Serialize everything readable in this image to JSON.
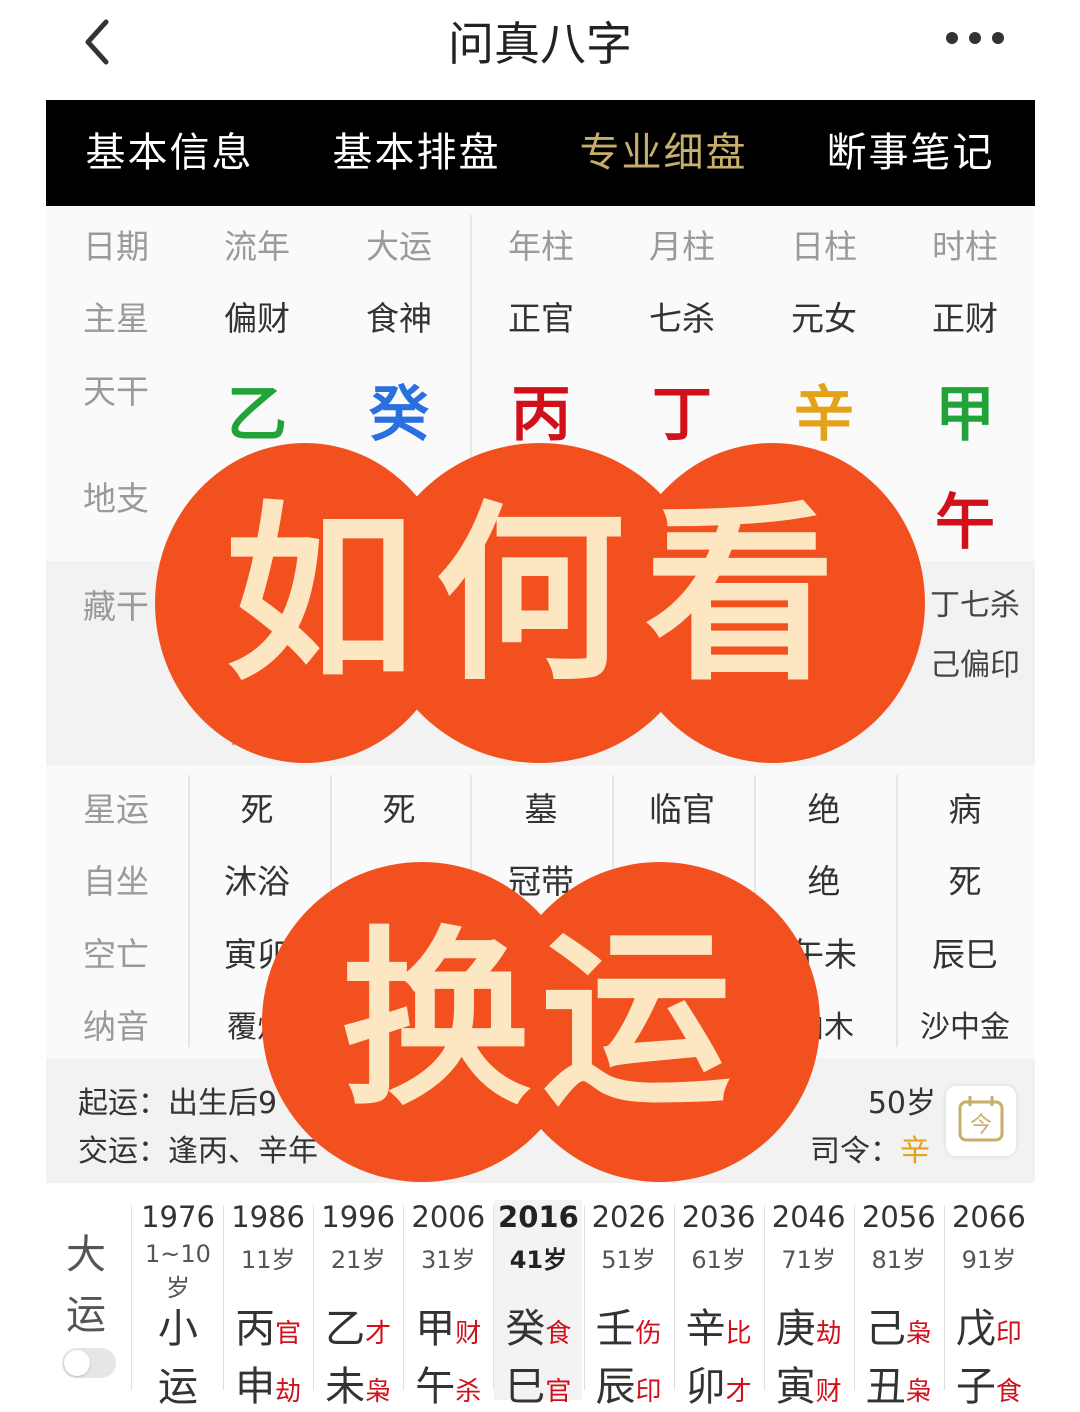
{
  "header": {
    "title": "问真八字"
  },
  "tabs": [
    {
      "label": "基本信息"
    },
    {
      "label": "基本排盘"
    },
    {
      "label": "专业细盘"
    },
    {
      "label": "断事笔记"
    }
  ],
  "pillars": {
    "header": [
      "日期",
      "流年",
      "大运",
      "年柱",
      "月柱",
      "日柱",
      "时柱"
    ],
    "zhuxing": {
      "label": "主星",
      "values": [
        "偏财",
        "食神",
        "正官",
        "七杀",
        "元女",
        "正财"
      ]
    },
    "tiangan": {
      "label": "天干",
      "values": [
        "乙",
        "癸",
        "丙",
        "丁",
        "辛",
        "甲"
      ]
    },
    "dizhi": {
      "label": "地支",
      "visible_value": "午"
    },
    "canggan": {
      "label": "藏干",
      "partial_1": "丁七杀",
      "partial_2": "己偏印",
      "partial_3": "戊"
    }
  },
  "colors": {
    "wood": "#22a33a",
    "water": "#2a6fe0",
    "fire": "#d0111b",
    "metal": "#e3a21a",
    "accent": "#c8ae6b",
    "badge": "#f2501f"
  },
  "stats": {
    "xingyun": {
      "label": "星运",
      "values": [
        "死",
        "死",
        "墓",
        "临官",
        "绝",
        "病"
      ]
    },
    "zizuo": {
      "label": "自坐",
      "values": [
        "沐浴",
        "",
        "冠带",
        "",
        "绝",
        "死"
      ]
    },
    "kongwang": {
      "label": "空亡",
      "values": [
        "寅卯",
        "",
        "",
        "",
        "午未",
        "辰巳"
      ]
    },
    "nayin": {
      "label": "纳音",
      "values": [
        "覆灯",
        "",
        "",
        "",
        "柏木",
        "沙中金"
      ]
    }
  },
  "yun": {
    "qiyun_label": "起运：",
    "qiyun_value": "出生后9",
    "jiaoyun_label": "交运：",
    "jiaoyun_value": "逢丙、辛年",
    "age_value": "50岁",
    "siling_label": "司令：",
    "siling_value": "辛"
  },
  "dayun": {
    "label_1": "大",
    "label_2": "运",
    "columns": [
      {
        "year": "1976",
        "age": "1~10岁",
        "gan": "小",
        "gan_tag": "",
        "zhi": "运",
        "zhi_tag": ""
      },
      {
        "year": "1986",
        "age": "11岁",
        "gan": "丙",
        "gan_tag": "官",
        "zhi": "申",
        "zhi_tag": "劫"
      },
      {
        "year": "1996",
        "age": "21岁",
        "gan": "乙",
        "gan_tag": "才",
        "zhi": "未",
        "zhi_tag": "枭"
      },
      {
        "year": "2006",
        "age": "31岁",
        "gan": "甲",
        "gan_tag": "财",
        "zhi": "午",
        "zhi_tag": "杀"
      },
      {
        "year": "2016",
        "age": "41岁",
        "gan": "癸",
        "gan_tag": "食",
        "zhi": "巳",
        "zhi_tag": "官"
      },
      {
        "year": "2026",
        "age": "51岁",
        "gan": "壬",
        "gan_tag": "伤",
        "zhi": "辰",
        "zhi_tag": "印"
      },
      {
        "year": "2036",
        "age": "61岁",
        "gan": "辛",
        "gan_tag": "比",
        "zhi": "卯",
        "zhi_tag": "才"
      },
      {
        "year": "2046",
        "age": "71岁",
        "gan": "庚",
        "gan_tag": "劫",
        "zhi": "寅",
        "zhi_tag": "财"
      },
      {
        "year": "2056",
        "age": "81岁",
        "gan": "己",
        "gan_tag": "枭",
        "zhi": "丑",
        "zhi_tag": "枭"
      },
      {
        "year": "2066",
        "age": "91岁",
        "gan": "戊",
        "gan_tag": "印",
        "zhi": "子",
        "zhi_tag": "食"
      }
    ]
  },
  "overlay": {
    "headline": "如何看",
    "subline": "换运"
  }
}
